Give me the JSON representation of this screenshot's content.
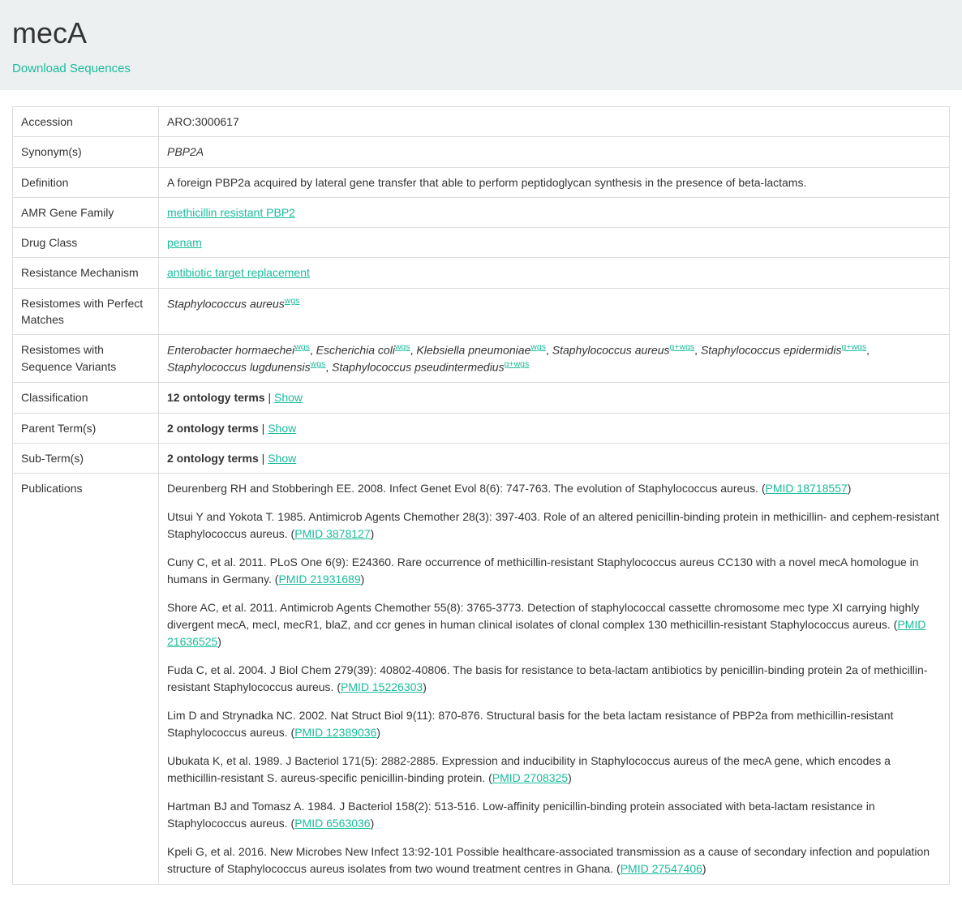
{
  "header": {
    "title": "mecA",
    "download_link": "Download Sequences"
  },
  "rows": {
    "accession": {
      "label": "Accession",
      "value": "ARO:3000617"
    },
    "synonyms": {
      "label": "Synonym(s)",
      "value": "PBP2A"
    },
    "definition": {
      "label": "Definition",
      "value": "A foreign PBP2a acquired by lateral gene transfer that able to perform peptidoglycan synthesis in the presence of beta-lactams."
    },
    "amr_family": {
      "label": "AMR Gene Family",
      "value": "methicillin resistant PBP2"
    },
    "drug_class": {
      "label": "Drug Class",
      "value": "penam"
    },
    "resistance_mechanism": {
      "label": "Resistance Mechanism",
      "value": "antibiotic target replacement"
    },
    "perfect_matches": {
      "label": "Resistomes with Perfect Matches",
      "items": [
        {
          "name": "Staphylococcus aureus",
          "tag": "wgs"
        }
      ]
    },
    "sequence_variants": {
      "label": "Resistomes with Sequence Variants",
      "items": [
        {
          "name": "Enterobacter hormaechei",
          "tag": "wgs"
        },
        {
          "name": "Escherichia coli",
          "tag": "wgs"
        },
        {
          "name": "Klebsiella pneumoniae",
          "tag": "wgs"
        },
        {
          "name": "Staphylococcus aureus",
          "tag": "g+wgs"
        },
        {
          "name": "Staphylococcus epidermidis",
          "tag": "g+wgs"
        },
        {
          "name": "Staphylococcus lugdunensis",
          "tag": "wgs"
        },
        {
          "name": "Staphylococcus pseudintermedius",
          "tag": "g+wgs"
        }
      ]
    },
    "classification": {
      "label": "Classification",
      "count": "12 ontology terms",
      "sep": " | ",
      "show": "Show"
    },
    "parent_terms": {
      "label": "Parent Term(s)",
      "count": "2 ontology terms",
      "sep": " | ",
      "show": "Show"
    },
    "sub_terms": {
      "label": "Sub-Term(s)",
      "count": "2 ontology terms",
      "sep": " | ",
      "show": "Show"
    },
    "publications": {
      "label": "Publications",
      "items": [
        {
          "text": "Deurenberg RH and Stobberingh EE. 2008. Infect Genet Evol 8(6): 747-763. The evolution of Staphylococcus aureus. (",
          "pmid": "PMID 18718557",
          "close": ")"
        },
        {
          "text": "Utsui Y and Yokota T. 1985. Antimicrob Agents Chemother 28(3): 397-403. Role of an altered penicillin-binding protein in methicillin- and cephem-resistant Staphylococcus aureus. (",
          "pmid": "PMID 3878127",
          "close": ")"
        },
        {
          "text": "Cuny C, et al. 2011. PLoS One 6(9): E24360. Rare occurrence of methicillin-resistant Staphylococcus aureus CC130 with a novel mecA homologue in humans in Germany. (",
          "pmid": "PMID 21931689",
          "close": ")"
        },
        {
          "text": "Shore AC, et al. 2011. Antimicrob Agents Chemother 55(8): 3765-3773. Detection of staphylococcal cassette chromosome mec type XI carrying highly divergent mecA, mecI, mecR1, blaZ, and ccr genes in human clinical isolates of clonal complex 130 methicillin-resistant Staphylococcus aureus. (",
          "pmid": "PMID 21636525",
          "close": ")"
        },
        {
          "text": "Fuda C, et al. 2004. J Biol Chem 279(39): 40802-40806. The basis for resistance to beta-lactam antibiotics by penicillin-binding protein 2a of methicillin-resistant Staphylococcus aureus. (",
          "pmid": "PMID 15226303",
          "close": ")"
        },
        {
          "text": "Lim D and Strynadka NC. 2002. Nat Struct Biol 9(11): 870-876. Structural basis for the beta lactam resistance of PBP2a from methicillin-resistant Staphylococcus aureus. (",
          "pmid": "PMID 12389036",
          "close": ")"
        },
        {
          "text": "Ubukata K, et al. 1989. J Bacteriol 171(5): 2882-2885. Expression and inducibility in Staphylococcus aureus of the mecA gene, which encodes a methicillin-resistant S. aureus-specific penicillin-binding protein. (",
          "pmid": "PMID 2708325",
          "close": ")"
        },
        {
          "text": "Hartman BJ and Tomasz A. 1984. J Bacteriol 158(2): 513-516. Low-affinity penicillin-binding protein associated with beta-lactam resistance in Staphylococcus aureus. (",
          "pmid": "PMID 6563036",
          "close": ")"
        },
        {
          "text": "Kpeli G, et al. 2016. New Microbes New Infect 13:92-101 Possible healthcare-associated transmission as a cause of secondary infection and population structure of Staphylococcus aureus isolates from two wound treatment centres in Ghana. (",
          "pmid": "PMID 27547406",
          "close": ")"
        }
      ]
    }
  }
}
